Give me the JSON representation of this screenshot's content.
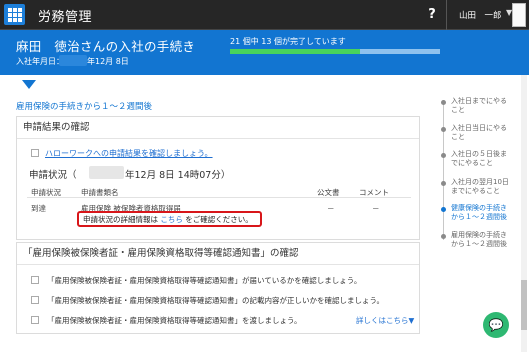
{
  "app": {
    "title": "労務管理",
    "help": "?",
    "user_name": "山田　一郎"
  },
  "header": {
    "employee_procedure": "麻田　徳治さんの入社の手続き",
    "join_label": "入社年月日：",
    "join_date": "年12月 8日",
    "progress_text": "21 個中 13 個が完了しています",
    "progress_done": 13,
    "progress_total": 21
  },
  "main": {
    "section_title": "雇用保険の手続きから１～２週間後",
    "card1": {
      "title": "申請結果の確認",
      "check_link": "ハローワークへの申請結果を確認しましょう。",
      "status_prefix": "申請状況（",
      "status_date": "年12月 8日 14時07分）",
      "columns": [
        "申請状況",
        "申請書類名",
        "公文書",
        "コメント"
      ],
      "row": {
        "status": "到達",
        "doc_name": "雇用保険 被保険者資格取得届",
        "official": "－",
        "comment": "－"
      },
      "detail_prefix": "申請状況の詳細情報は",
      "detail_link": "こちら",
      "detail_suffix": "をご確認ください。"
    },
    "card2": {
      "title": "「雇用保険被保険者証・雇用保険資格取得等確認通知書」の確認",
      "items": [
        "「雇用保険被保険者証・雇用保険資格取得等確認通知書」が届いているかを確認しましょう。",
        "「雇用保険被保険者証・雇用保険資格取得等確認通知書」の記載内容が正しいかを確認しましょう。",
        "「雇用保険被保険者証・雇用保険資格取得等確認通知書」を渡しましょう。"
      ],
      "more_link": "詳しくはこちら▼"
    }
  },
  "side_nav": [
    {
      "label_1": "入社日までにやる",
      "label_2": "こと",
      "active": false
    },
    {
      "label_1": "入社日当日にやる",
      "label_2": "こと",
      "active": false
    },
    {
      "label_1": "入社日の５日後ま",
      "label_2": "でにやること",
      "active": false
    },
    {
      "label_1": "入社月の翌月10日",
      "label_2": "までにやること",
      "active": false
    },
    {
      "label_1": "健康保険の手続き",
      "label_2": "から１～２週間後",
      "active": true
    },
    {
      "label_1": "雇用保険の手続き",
      "label_2": "から１～２週間後",
      "active": false
    }
  ],
  "colors": {
    "accent": "#1275d1",
    "appbar": "#262626",
    "progress": "#48d35c",
    "highlight": "#d8161a",
    "chat": "#2eb872"
  },
  "icons": {
    "app_menu": "grid-icon",
    "chat": "chat-bubble-icon",
    "user_menu": "caret-down-icon"
  }
}
